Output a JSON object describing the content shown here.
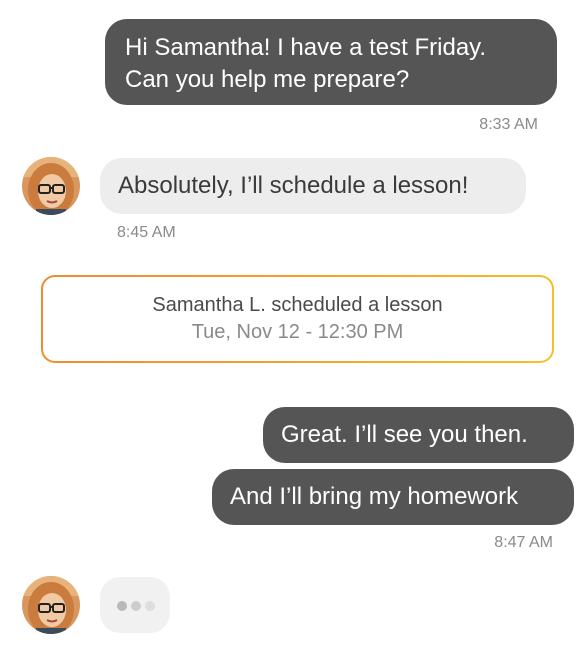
{
  "messages": [
    {
      "direction": "outgoing",
      "lines": [
        "Hi Samantha! I have a test Friday.",
        "Can you help me prepare?"
      ]
    },
    {
      "direction": "incoming",
      "text": "Absolutely, I’ll schedule a lesson!"
    },
    {
      "direction": "outgoing",
      "text": "Great. I’ll see you then."
    },
    {
      "direction": "outgoing",
      "text": "And I’ll bring my homework"
    }
  ],
  "timestamps": {
    "first": "8:33 AM",
    "second": "8:45 AM",
    "third": "8:47 AM"
  },
  "event": {
    "title": "Samantha L. scheduled a lesson",
    "datetime": "Tue, Nov 12 - 12:30 PM"
  },
  "colors": {
    "outgoing_bubble": "#555555",
    "incoming_bubble": "#ededed",
    "event_border_start": "#f08a2c",
    "event_border_end": "#f3c22a"
  },
  "icons": {
    "avatar": "tutor-avatar-photo",
    "typing": "typing-indicator-dots"
  }
}
